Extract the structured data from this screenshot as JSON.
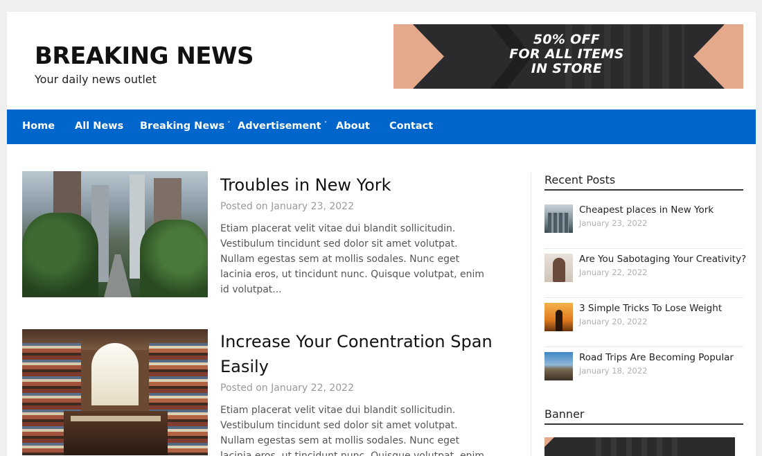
{
  "site": {
    "title": "BREAKING NEWS",
    "tagline": "Your daily news outlet"
  },
  "header_ad": {
    "line1": "50% OFF",
    "line2": "FOR ALL ITEMS",
    "line3": "IN STORE"
  },
  "nav": {
    "items": [
      {
        "label": "Home"
      },
      {
        "label": "All News"
      },
      {
        "label": "Breaking News",
        "caret": "˅"
      },
      {
        "label": "Advertisement",
        "caret": "˅"
      },
      {
        "label": "About"
      },
      {
        "label": "Contact"
      }
    ]
  },
  "posts": [
    {
      "title": "Troubles in New York",
      "date": "Posted on January 23, 2022",
      "excerpt": "Etiam placerat velit vitae dui blandit sollicitudin. Vestibulum tincidunt sed dolor sit amet volutpat. Nullam egestas sem at mollis sodales. Nunc eget lacinia eros, ut tincidunt nunc. Quisque volutpat, enim id volutpat..."
    },
    {
      "title": "Increase Your Conentration Span Easily",
      "date": "Posted on January 22, 2022",
      "excerpt": "Etiam placerat velit vitae dui blandit sollicitudin. Vestibulum tincidunt sed dolor sit amet volutpat. Nullam egestas sem at mollis sodales. Nunc eget lacinia eros, ut tincidunt nunc. Quisque volutpat, enim"
    }
  ],
  "sidebar": {
    "recent_title": "Recent Posts",
    "recent": [
      {
        "title": "Cheapest places in New York",
        "date": "January 23, 2022"
      },
      {
        "title": "Are You Sabotaging Your Creativity?",
        "date": "January 22, 2022"
      },
      {
        "title": "3 Simple Tricks To Lose Weight",
        "date": "January 20, 2022"
      },
      {
        "title": "Road Trips Are Becoming Popular",
        "date": "January 18, 2022"
      }
    ],
    "banner_title": "Banner"
  },
  "colors": {
    "nav_background": "#0066cc",
    "page_background": "#efefef",
    "ad_accent": "#e4a98b"
  }
}
